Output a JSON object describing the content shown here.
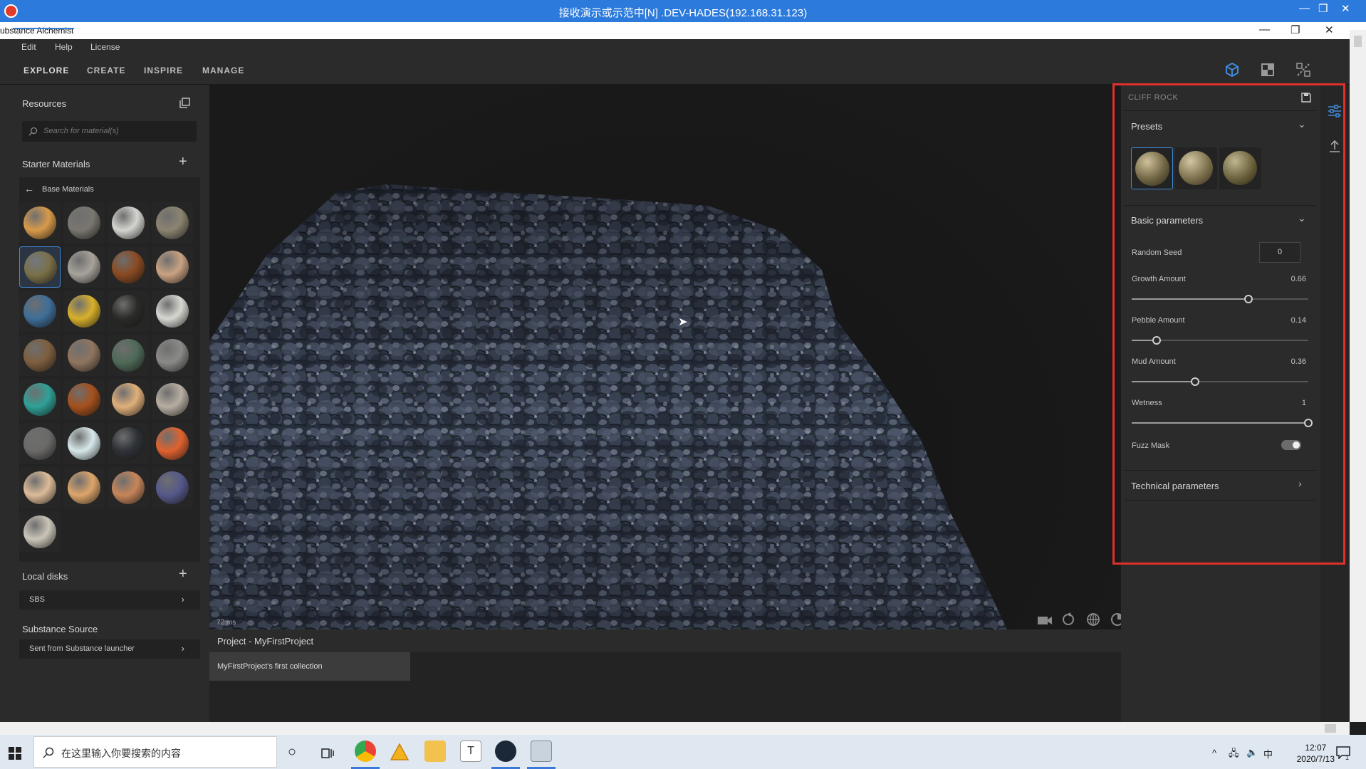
{
  "remote_session": {
    "title": "接收演示或示范中[N] .DEV-HADES(192.168.31.123)",
    "minimize": "—",
    "restore": "❐",
    "close": "✕"
  },
  "window": {
    "title": "ubstance Alchemist",
    "minimize": "—",
    "restore": "❐",
    "close": "✕"
  },
  "menu": [
    "Edit",
    "Help",
    "License"
  ],
  "tabs": [
    {
      "label": "EXPLORE",
      "active": true
    },
    {
      "label": "CREATE",
      "active": false
    },
    {
      "label": "INSPIRE",
      "active": false
    },
    {
      "label": "MANAGE",
      "active": false
    }
  ],
  "sidebar": {
    "resources_title": "Resources",
    "search_placeholder": "Search for material(s)",
    "starter_title": "Starter Materials",
    "back_label": "Base Materials",
    "local_disks_title": "Local disks",
    "local_disks_items": [
      {
        "label": "SBS"
      }
    ],
    "source_title": "Substance Source",
    "source_items": [
      {
        "label": "Sent from Substance launcher"
      }
    ]
  },
  "materials": [
    {
      "name": "orange-clay",
      "color": "#d89a4a",
      "selected": false
    },
    {
      "name": "grey-stone",
      "color": "#7a7670",
      "selected": false
    },
    {
      "name": "white-plaster",
      "color": "#d4d4d0",
      "selected": false
    },
    {
      "name": "olive-ground",
      "color": "#8b8470",
      "selected": false
    },
    {
      "name": "cliff-rock",
      "color": "#7a7048",
      "selected": true
    },
    {
      "name": "light-grey",
      "color": "#a7a29a",
      "selected": false
    },
    {
      "name": "copper",
      "color": "#8a4a22",
      "selected": false
    },
    {
      "name": "beige-cobble",
      "color": "#c9a282",
      "selected": false
    },
    {
      "name": "blue-paint",
      "color": "#3e6e98",
      "selected": false
    },
    {
      "name": "gold",
      "color": "#d8b02a",
      "selected": false
    },
    {
      "name": "black-rubber",
      "color": "#2b2b28",
      "selected": false
    },
    {
      "name": "cracked-white",
      "color": "#d7d7d2",
      "selected": false
    },
    {
      "name": "brown-dirt",
      "color": "#7e5e3e",
      "selected": false
    },
    {
      "name": "wood-bark",
      "color": "#8f7560",
      "selected": false
    },
    {
      "name": "green-metal",
      "color": "#4f6a58",
      "selected": false
    },
    {
      "name": "grey-concrete",
      "color": "#8a8a88",
      "selected": false
    },
    {
      "name": "teal-plastic",
      "color": "#2fa097",
      "selected": false
    },
    {
      "name": "rust",
      "color": "#a4501c",
      "selected": false
    },
    {
      "name": "sand",
      "color": "#e0b07a",
      "selected": false
    },
    {
      "name": "light-stone",
      "color": "#b7aea2",
      "selected": false
    },
    {
      "name": "dark-concrete",
      "color": "#6b6a68",
      "selected": false
    },
    {
      "name": "ice",
      "color": "#d8e8ea",
      "selected": false
    },
    {
      "name": "dark-chrome",
      "color": "#2e3236",
      "selected": false
    },
    {
      "name": "orange-rubber",
      "color": "#e0622e",
      "selected": false
    },
    {
      "name": "tan-plaster",
      "color": "#dcbb98",
      "selected": false
    },
    {
      "name": "peach-sand",
      "color": "#dda56a",
      "selected": false
    },
    {
      "name": "leather",
      "color": "#c7855a",
      "selected": false
    },
    {
      "name": "slate-blue",
      "color": "#55598a",
      "selected": false
    },
    {
      "name": "bone",
      "color": "#cbc5b8",
      "selected": false
    }
  ],
  "viewport": {
    "render_time": "72 ms"
  },
  "project": {
    "title": "Project - MyFirstProject",
    "collection": "MyFirstProject's first collection"
  },
  "panel": {
    "material_title": "CLIFF ROCK",
    "presets_title": "Presets",
    "basic_title": "Basic parameters",
    "random_seed_label": "Random Seed",
    "random_seed_value": "0",
    "sliders": [
      {
        "label": "Growth Amount",
        "value_text": "0.66",
        "value": 0.66
      },
      {
        "label": "Pebble Amount",
        "value_text": "0.14",
        "value": 0.14
      },
      {
        "label": "Mud Amount",
        "value_text": "0.36",
        "value": 0.36
      },
      {
        "label": "Wetness",
        "value_text": "1",
        "value": 1.0
      }
    ],
    "fuzz_mask_label": "Fuzz Mask",
    "fuzz_mask_on": true,
    "technical_title": "Technical parameters"
  },
  "taskbar": {
    "search_placeholder": "在这里输入你要搜索的内容",
    "time": "12:07",
    "date": "2020/7/13",
    "ime": "中",
    "notification_count": "1"
  },
  "colors": {
    "accent": "#2f7fd6",
    "highlight_box": "#e0302c",
    "panel_bg": "#2b2b2b",
    "rdp_bar": "#2c7bdc"
  }
}
